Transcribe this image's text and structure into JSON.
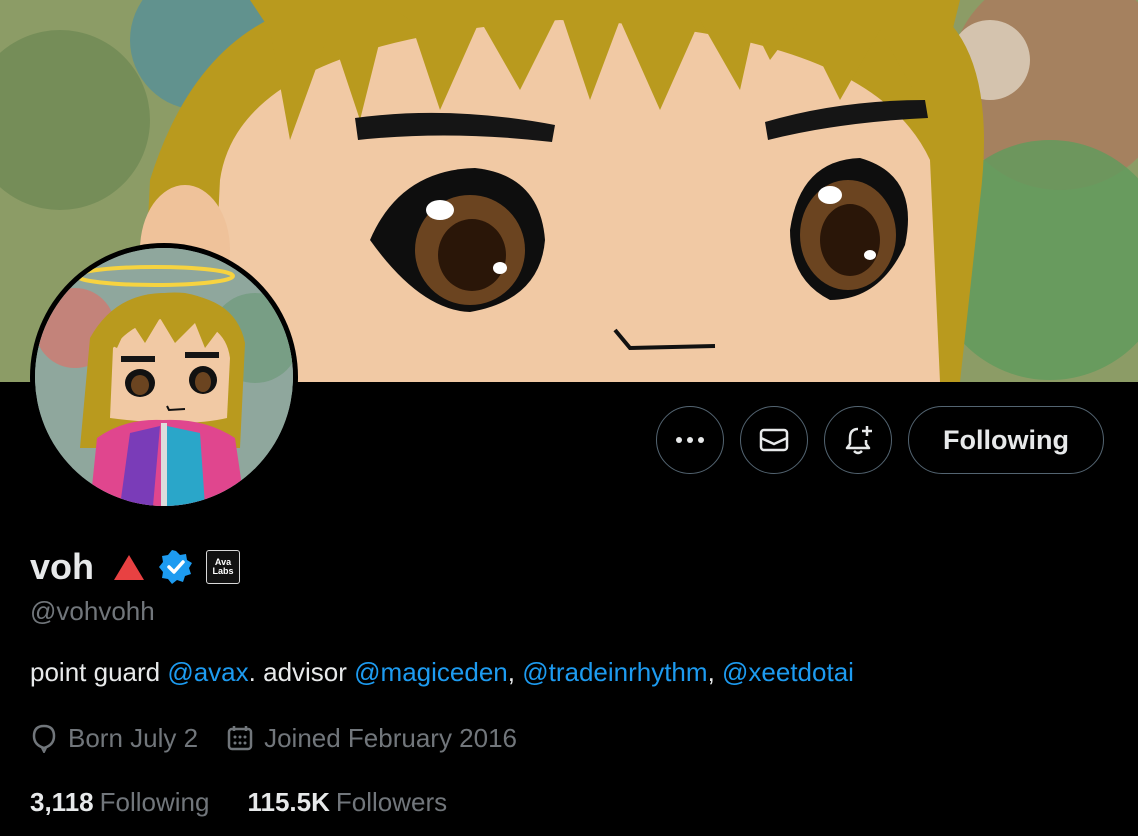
{
  "profile": {
    "display_name": "voh",
    "handle": "@vohvohh",
    "affiliate_badge_line1": "Ava",
    "affiliate_badge_line2": "Labs",
    "bio": {
      "prefix": "point guard ",
      "mention1": "@avax",
      "text1": ". advisor ",
      "mention2": "@magiceden",
      "sep1": ", ",
      "mention3": "@tradeinrhythm",
      "sep2": ", ",
      "mention4": "@xeetdotai"
    },
    "birthday": "Born July 2",
    "joined": "Joined February 2016",
    "following_count": "3,118",
    "following_label": "Following",
    "followers_count": "115.5K",
    "followers_label": "Followers"
  },
  "actions": {
    "following_button_label": "Following",
    "more_icon": "more-horizontal-icon",
    "message_icon": "envelope-icon",
    "notify_icon": "bell-plus-icon"
  },
  "colors": {
    "background": "#000000",
    "text_primary": "#e7e9ea",
    "text_secondary": "#71767b",
    "link": "#1d9bf0",
    "border": "#536471",
    "verified": "#1d9bf0",
    "triangle": "#e84142"
  }
}
